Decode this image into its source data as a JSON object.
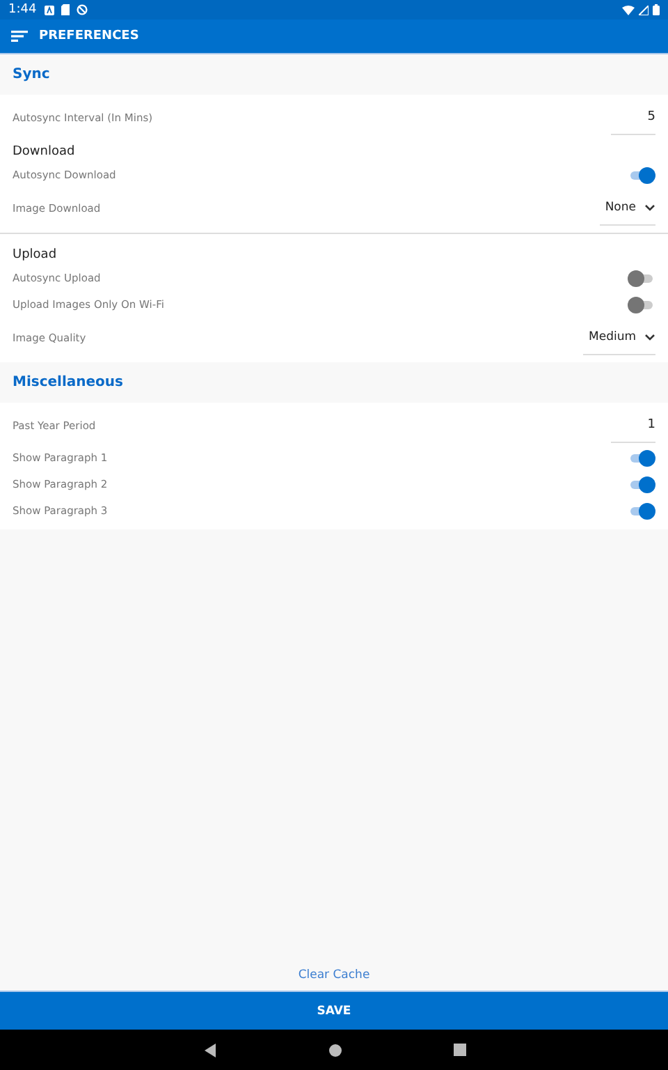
{
  "status_bar": {
    "time": "1:44"
  },
  "toolbar": {
    "title": "PREFERENCES"
  },
  "sections": [
    {
      "title": "Sync",
      "rows": [
        {
          "kind": "number",
          "label": "Autosync Interval (In Mins)",
          "value": "5"
        },
        {
          "kind": "subheading",
          "label": "Download"
        },
        {
          "kind": "toggle",
          "label": "Autosync Download",
          "on": true
        },
        {
          "kind": "select",
          "label": "Image Download",
          "value": "None"
        },
        {
          "kind": "divider"
        },
        {
          "kind": "subheading",
          "label": "Upload"
        },
        {
          "kind": "toggle",
          "label": "Autosync Upload",
          "on": false
        },
        {
          "kind": "toggle",
          "label": "Upload Images Only On Wi-Fi",
          "on": false
        },
        {
          "kind": "select",
          "label": "Image Quality",
          "value": "Medium"
        }
      ]
    },
    {
      "title": "Miscellaneous",
      "rows": [
        {
          "kind": "number",
          "label": "Past Year Period",
          "value": "1"
        },
        {
          "kind": "toggle",
          "label": "Show Paragraph 1",
          "on": true
        },
        {
          "kind": "toggle",
          "label": "Show Paragraph 2",
          "on": true
        },
        {
          "kind": "toggle",
          "label": "Show Paragraph 3",
          "on": true
        }
      ]
    }
  ],
  "clear_cache": "Clear Cache",
  "save": "SAVE"
}
